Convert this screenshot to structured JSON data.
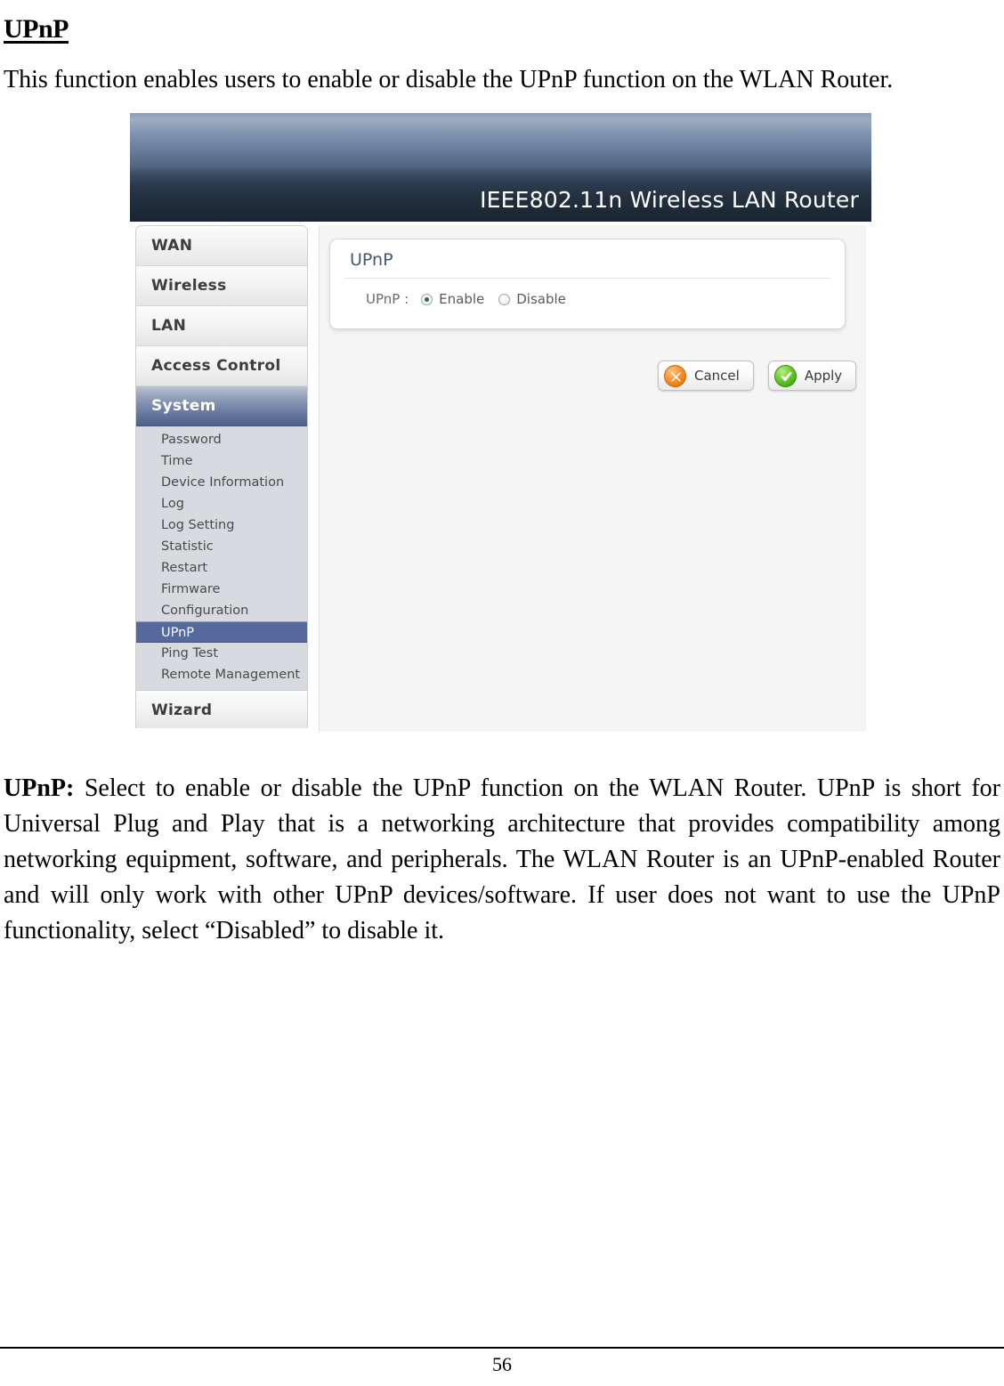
{
  "document": {
    "heading": "UPnP",
    "intro_paragraph": "This function enables users to enable or disable the UPnP function on the WLAN Router.",
    "body_label": "UPnP:",
    "body_paragraph": " Select to enable or disable the UPnP function on the WLAN Router. UPnP is short for Universal Plug and Play that is a networking architecture that provides compatibility among networking equipment, software, and peripherals. The WLAN Router is an UPnP-enabled Router and will only work with other UPnP devices/software. If user does not want to use the UPnP functionality, select “Disabled” to disable it.",
    "page_number": "56"
  },
  "router_ui": {
    "header": {
      "title": "IEEE802.11n  Wireless LAN Router"
    },
    "sidebar": {
      "main_items": [
        {
          "label": "WAN",
          "active": false
        },
        {
          "label": "Wireless",
          "active": false
        },
        {
          "label": "LAN",
          "active": false
        },
        {
          "label": "Access Control",
          "active": false
        },
        {
          "label": "System",
          "active": true
        },
        {
          "label": "Wizard",
          "active": false
        }
      ],
      "system_submenu": [
        {
          "label": "Password",
          "active": false
        },
        {
          "label": "Time",
          "active": false
        },
        {
          "label": "Device Information",
          "active": false
        },
        {
          "label": "Log",
          "active": false
        },
        {
          "label": "Log Setting",
          "active": false
        },
        {
          "label": "Statistic",
          "active": false
        },
        {
          "label": "Restart",
          "active": false
        },
        {
          "label": "Firmware",
          "active": false
        },
        {
          "label": "Configuration",
          "active": false
        },
        {
          "label": "UPnP",
          "active": true
        },
        {
          "label": "Ping Test",
          "active": false
        },
        {
          "label": "Remote Management",
          "active": false
        }
      ]
    },
    "panel": {
      "title": "UPnP",
      "row_label": "UPnP :",
      "options": [
        {
          "label": "Enable",
          "selected": true
        },
        {
          "label": "Disable",
          "selected": false
        }
      ]
    },
    "buttons": {
      "cancel_label": "Cancel",
      "apply_label": "Apply"
    },
    "colors": {
      "header_top": "#8d9cb4",
      "header_bottom": "#192533",
      "active_main_item": "#4e6289",
      "active_sub_item": "#56699c",
      "panel_title": "#44566e",
      "cancel_icon": "#ea7d14",
      "apply_icon": "#45b512",
      "radio_dot": "#2f6b44"
    }
  }
}
